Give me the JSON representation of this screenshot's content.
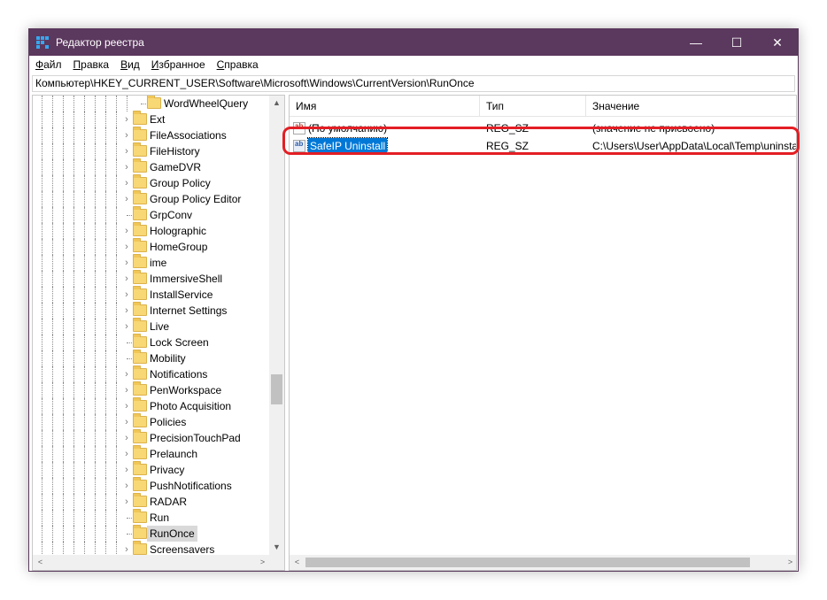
{
  "window": {
    "title": "Редактор реестра",
    "controls": {
      "minimize": "—",
      "maximize": "☐",
      "close": "✕"
    }
  },
  "menu": [
    {
      "first": "Ф",
      "rest": "айл"
    },
    {
      "first": "П",
      "rest": "равка"
    },
    {
      "first": "В",
      "rest": "ид"
    },
    {
      "first": "И",
      "rest": "збранное"
    },
    {
      "first": "С",
      "rest": "правка"
    }
  ],
  "address": "Компьютер\\HKEY_CURRENT_USER\\Software\\Microsoft\\Windows\\CurrentVersion\\RunOnce",
  "tree": [
    {
      "label": "WordWheelQuery",
      "depth": 1,
      "expandable": false,
      "selected": false
    },
    {
      "label": "Ext",
      "depth": 0,
      "expandable": true,
      "selected": false
    },
    {
      "label": "FileAssociations",
      "depth": 0,
      "expandable": true,
      "selected": false
    },
    {
      "label": "FileHistory",
      "depth": 0,
      "expandable": true,
      "selected": false
    },
    {
      "label": "GameDVR",
      "depth": 0,
      "expandable": true,
      "selected": false
    },
    {
      "label": "Group Policy",
      "depth": 0,
      "expandable": true,
      "selected": false
    },
    {
      "label": "Group Policy Editor",
      "depth": 0,
      "expandable": true,
      "selected": false
    },
    {
      "label": "GrpConv",
      "depth": 0,
      "expandable": false,
      "selected": false
    },
    {
      "label": "Holographic",
      "depth": 0,
      "expandable": true,
      "selected": false
    },
    {
      "label": "HomeGroup",
      "depth": 0,
      "expandable": true,
      "selected": false
    },
    {
      "label": "ime",
      "depth": 0,
      "expandable": true,
      "selected": false
    },
    {
      "label": "ImmersiveShell",
      "depth": 0,
      "expandable": true,
      "selected": false
    },
    {
      "label": "InstallService",
      "depth": 0,
      "expandable": true,
      "selected": false
    },
    {
      "label": "Internet Settings",
      "depth": 0,
      "expandable": true,
      "selected": false
    },
    {
      "label": "Live",
      "depth": 0,
      "expandable": true,
      "selected": false
    },
    {
      "label": "Lock Screen",
      "depth": 0,
      "expandable": false,
      "selected": false
    },
    {
      "label": "Mobility",
      "depth": 0,
      "expandable": false,
      "selected": false
    },
    {
      "label": "Notifications",
      "depth": 0,
      "expandable": true,
      "selected": false
    },
    {
      "label": "PenWorkspace",
      "depth": 0,
      "expandable": true,
      "selected": false
    },
    {
      "label": "Photo Acquisition",
      "depth": 0,
      "expandable": true,
      "selected": false
    },
    {
      "label": "Policies",
      "depth": 0,
      "expandable": true,
      "selected": false
    },
    {
      "label": "PrecisionTouchPad",
      "depth": 0,
      "expandable": true,
      "selected": false
    },
    {
      "label": "Prelaunch",
      "depth": 0,
      "expandable": true,
      "selected": false
    },
    {
      "label": "Privacy",
      "depth": 0,
      "expandable": true,
      "selected": false
    },
    {
      "label": "PushNotifications",
      "depth": 0,
      "expandable": true,
      "selected": false
    },
    {
      "label": "RADAR",
      "depth": 0,
      "expandable": true,
      "selected": false
    },
    {
      "label": "Run",
      "depth": 0,
      "expandable": false,
      "selected": false
    },
    {
      "label": "RunOnce",
      "depth": 0,
      "expandable": false,
      "selected": true
    },
    {
      "label": "Screensavers",
      "depth": 0,
      "expandable": true,
      "selected": false
    }
  ],
  "tree_scroll": {
    "up": "▲",
    "down": "▼",
    "left": "<",
    "right": ">",
    "vertical_position": 0.66,
    "vertical_fraction": 0.07
  },
  "columns": {
    "name": "Имя",
    "type": "Тип",
    "value": "Значение"
  },
  "values": [
    {
      "icon": "ab",
      "name": "(По умолчанию)",
      "type": "REG_SZ",
      "data": "(значение не присвоено)",
      "selected": false
    },
    {
      "icon": "ab",
      "name": "SafeIP Uninstall",
      "type": "REG_SZ",
      "data": "C:\\Users\\User\\AppData\\Local\\Temp\\uninstall",
      "selected": true
    }
  ],
  "list_scroll": {
    "left": "<",
    "right": ">",
    "horizontal_fraction": 0.93
  },
  "colors": {
    "titlebar": "#5b385e",
    "selection": "#0078d7",
    "highlight": "#e31e24",
    "folder": "#f8d775"
  }
}
